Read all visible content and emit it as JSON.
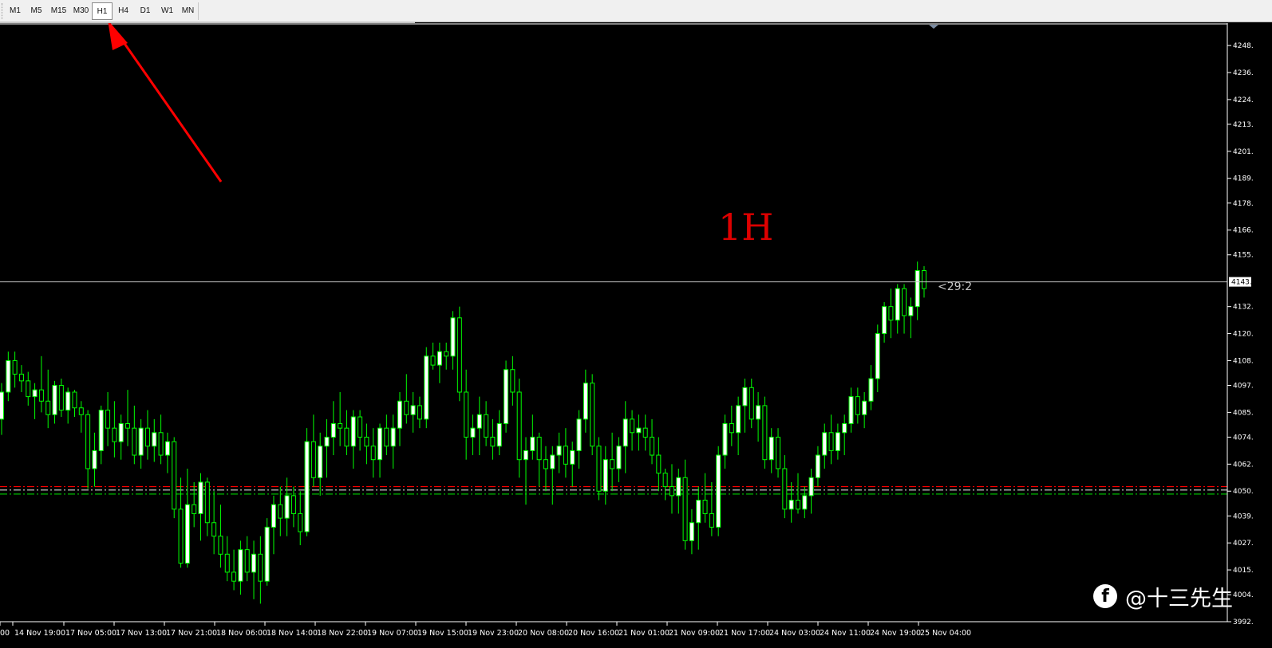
{
  "toolbar": {
    "timeframes": [
      {
        "label": "M1",
        "active": false
      },
      {
        "label": "M5",
        "active": false
      },
      {
        "label": "M15",
        "active": false
      },
      {
        "label": "M30",
        "active": false
      },
      {
        "label": "H1",
        "active": true
      },
      {
        "label": "H4",
        "active": false
      },
      {
        "label": "D1",
        "active": false
      },
      {
        "label": "W1",
        "active": false
      },
      {
        "label": "MN",
        "active": false
      }
    ]
  },
  "annotation": {
    "timeframe_label": "1H",
    "arrow_color": "#ff0000"
  },
  "price_axis": {
    "ticks": [
      "4248.",
      "4236.",
      "4224.",
      "4213.",
      "4201.",
      "4189.",
      "4178.",
      "4166.",
      "4155.",
      "4132.",
      "4120.",
      "4108.",
      "4097.",
      "4085.",
      "4074.",
      "4062.",
      "4050.",
      "4039.",
      "4027.",
      "4015.",
      "4004.",
      "3992."
    ],
    "current_price_label": "4143."
  },
  "countdown_label": "<29:2",
  "time_axis": {
    "ticks": [
      "00",
      "14 Nov 19:00",
      "17 Nov 05:00",
      "17 Nov 13:00",
      "17 Nov 21:00",
      "18 Nov 06:00",
      "18 Nov 14:00",
      "18 Nov 22:00",
      "19 Nov 07:00",
      "19 Nov 15:00",
      "19 Nov 23:00",
      "20 Nov 08:00",
      "20 Nov 16:00",
      "21 Nov 01:00",
      "21 Nov 09:00",
      "21 Nov 17:00",
      "24 Nov 03:00",
      "24 Nov 11:00",
      "24 Nov 19:00",
      "25 Nov 04:00"
    ]
  },
  "colors": {
    "background": "#000000",
    "bull_fill": "#ffffff",
    "bear_fill": "#000000",
    "candle_stroke": "#00ff00",
    "bid_line": "#c0c0c0",
    "level_line_red": "#ff0000",
    "level_line_white": "#e0e0e0",
    "level_line_green": "#00c000"
  },
  "watermark": {
    "icon": "facebook-icon",
    "text": "@十三先生"
  },
  "chart_data": {
    "type": "candlestick",
    "ylim": [
      3992,
      4253
    ],
    "current_price": 4143,
    "horizontal_levels": [
      {
        "price": 4052,
        "color": "#ff0000",
        "style": "dash-dot"
      },
      {
        "price": 4050.5,
        "color": "#e0e0e0",
        "style": "dash-dot"
      },
      {
        "price": 4048.7,
        "color": "#00c000",
        "style": "dash-dot"
      }
    ],
    "candles": [
      [
        4082,
        4098,
        4075,
        4094
      ],
      [
        4094,
        4112,
        4090,
        4108
      ],
      [
        4108,
        4112,
        4096,
        4102
      ],
      [
        4102,
        4106,
        4094,
        4099
      ],
      [
        4099,
        4103,
        4088,
        4092
      ],
      [
        4092,
        4098,
        4082,
        4095
      ],
      [
        4095,
        4110,
        4085,
        4090
      ],
      [
        4090,
        4104,
        4078,
        4084
      ],
      [
        4084,
        4099,
        4080,
        4097
      ],
      [
        4097,
        4100,
        4083,
        4086
      ],
      [
        4086,
        4096,
        4080,
        4094
      ],
      [
        4094,
        4095,
        4083,
        4087
      ],
      [
        4087,
        4090,
        4076,
        4084
      ],
      [
        4084,
        4086,
        4051,
        4060
      ],
      [
        4060,
        4076,
        4052,
        4068
      ],
      [
        4068,
        4088,
        4062,
        4086
      ],
      [
        4086,
        4094,
        4070,
        4078
      ],
      [
        4078,
        4090,
        4065,
        4072
      ],
      [
        4072,
        4084,
        4064,
        4080
      ],
      [
        4080,
        4095,
        4070,
        4078
      ],
      [
        4078,
        4088,
        4062,
        4066
      ],
      [
        4066,
        4082,
        4060,
        4078
      ],
      [
        4078,
        4086,
        4064,
        4070
      ],
      [
        4070,
        4082,
        4063,
        4076
      ],
      [
        4076,
        4084,
        4062,
        4066
      ],
      [
        4066,
        4076,
        4058,
        4072
      ],
      [
        4072,
        4074,
        4038,
        4042
      ],
      [
        4042,
        4056,
        4016,
        4018
      ],
      [
        4018,
        4060,
        4016,
        4044
      ],
      [
        4044,
        4054,
        4034,
        4040
      ],
      [
        4040,
        4058,
        4028,
        4054
      ],
      [
        4054,
        4056,
        4030,
        4036
      ],
      [
        4036,
        4050,
        4022,
        4030
      ],
      [
        4030,
        4044,
        4016,
        4022
      ],
      [
        4022,
        4030,
        4010,
        4014
      ],
      [
        4014,
        4024,
        4006,
        4010
      ],
      [
        4010,
        4028,
        4004,
        4024
      ],
      [
        4024,
        4030,
        4010,
        4014
      ],
      [
        4014,
        4028,
        4002,
        4022
      ],
      [
        4022,
        4030,
        4000,
        4010
      ],
      [
        4010,
        4038,
        4008,
        4034
      ],
      [
        4034,
        4048,
        4022,
        4044
      ],
      [
        4044,
        4052,
        4030,
        4038
      ],
      [
        4038,
        4056,
        4030,
        4048
      ],
      [
        4048,
        4052,
        4034,
        4040
      ],
      [
        4040,
        4050,
        4026,
        4032
      ],
      [
        4032,
        4078,
        4030,
        4072
      ],
      [
        4072,
        4084,
        4052,
        4056
      ],
      [
        4056,
        4076,
        4048,
        4070
      ],
      [
        4070,
        4082,
        4056,
        4074
      ],
      [
        4074,
        4090,
        4066,
        4080
      ],
      [
        4080,
        4094,
        4070,
        4078
      ],
      [
        4078,
        4086,
        4066,
        4070
      ],
      [
        4070,
        4086,
        4060,
        4083
      ],
      [
        4083,
        4086,
        4068,
        4074
      ],
      [
        4074,
        4080,
        4062,
        4070
      ],
      [
        4070,
        4078,
        4056,
        4064
      ],
      [
        4064,
        4080,
        4056,
        4078
      ],
      [
        4078,
        4084,
        4066,
        4070
      ],
      [
        4070,
        4084,
        4060,
        4078
      ],
      [
        4078,
        4094,
        4070,
        4090
      ],
      [
        4090,
        4102,
        4080,
        4084
      ],
      [
        4084,
        4094,
        4076,
        4088
      ],
      [
        4088,
        4092,
        4078,
        4082
      ],
      [
        4082,
        4114,
        4078,
        4110
      ],
      [
        4110,
        4116,
        4104,
        4106
      ],
      [
        4106,
        4116,
        4098,
        4112
      ],
      [
        4112,
        4116,
        4104,
        4110
      ],
      [
        4110,
        4130,
        4104,
        4127
      ],
      [
        4127,
        4132,
        4090,
        4094
      ],
      [
        4094,
        4104,
        4064,
        4074
      ],
      [
        4074,
        4084,
        4066,
        4078
      ],
      [
        4078,
        4092,
        4066,
        4084
      ],
      [
        4084,
        4090,
        4070,
        4074
      ],
      [
        4074,
        4082,
        4064,
        4070
      ],
      [
        4070,
        4086,
        4066,
        4080
      ],
      [
        4080,
        4108,
        4076,
        4104
      ],
      [
        4104,
        4110,
        4088,
        4094
      ],
      [
        4094,
        4100,
        4056,
        4064
      ],
      [
        4064,
        4074,
        4044,
        4068
      ],
      [
        4068,
        4084,
        4064,
        4074
      ],
      [
        4074,
        4076,
        4052,
        4064
      ],
      [
        4064,
        4070,
        4050,
        4060
      ],
      [
        4060,
        4070,
        4044,
        4066
      ],
      [
        4066,
        4076,
        4058,
        4070
      ],
      [
        4070,
        4078,
        4056,
        4062
      ],
      [
        4062,
        4072,
        4052,
        4068
      ],
      [
        4068,
        4086,
        4060,
        4082
      ],
      [
        4082,
        4104,
        4076,
        4098
      ],
      [
        4098,
        4102,
        4066,
        4070
      ],
      [
        4070,
        4074,
        4046,
        4050
      ],
      [
        4050,
        4070,
        4044,
        4064
      ],
      [
        4064,
        4076,
        4050,
        4060
      ],
      [
        4060,
        4074,
        4054,
        4070
      ],
      [
        4070,
        4090,
        4058,
        4082
      ],
      [
        4082,
        4086,
        4068,
        4076
      ],
      [
        4076,
        4084,
        4068,
        4078
      ],
      [
        4078,
        4084,
        4068,
        4074
      ],
      [
        4074,
        4082,
        4062,
        4066
      ],
      [
        4066,
        4074,
        4050,
        4058
      ],
      [
        4058,
        4060,
        4046,
        4052
      ],
      [
        4052,
        4062,
        4040,
        4048
      ],
      [
        4048,
        4060,
        4040,
        4056
      ],
      [
        4056,
        4064,
        4024,
        4028
      ],
      [
        4028,
        4042,
        4022,
        4036
      ],
      [
        4036,
        4052,
        4024,
        4046
      ],
      [
        4046,
        4058,
        4036,
        4040
      ],
      [
        4040,
        4054,
        4030,
        4034
      ],
      [
        4034,
        4070,
        4030,
        4066
      ],
      [
        4066,
        4084,
        4060,
        4080
      ],
      [
        4080,
        4088,
        4070,
        4076
      ],
      [
        4076,
        4092,
        4066,
        4088
      ],
      [
        4088,
        4100,
        4076,
        4096
      ],
      [
        4096,
        4100,
        4078,
        4082
      ],
      [
        4082,
        4094,
        4072,
        4088
      ],
      [
        4088,
        4092,
        4060,
        4064
      ],
      [
        4064,
        4078,
        4058,
        4074
      ],
      [
        4074,
        4078,
        4056,
        4060
      ],
      [
        4060,
        4066,
        4038,
        4042
      ],
      [
        4042,
        4054,
        4036,
        4046
      ],
      [
        4046,
        4058,
        4040,
        4042
      ],
      [
        4042,
        4052,
        4038,
        4048
      ],
      [
        4048,
        4060,
        4040,
        4056
      ],
      [
        4056,
        4070,
        4052,
        4066
      ],
      [
        4066,
        4080,
        4060,
        4076
      ],
      [
        4076,
        4084,
        4062,
        4068
      ],
      [
        4068,
        4080,
        4064,
        4076
      ],
      [
        4076,
        4084,
        4066,
        4080
      ],
      [
        4080,
        4096,
        4076,
        4092
      ],
      [
        4092,
        4096,
        4080,
        4084
      ],
      [
        4084,
        4094,
        4078,
        4090
      ],
      [
        4090,
        4106,
        4086,
        4100
      ],
      [
        4100,
        4124,
        4094,
        4120
      ],
      [
        4120,
        4134,
        4116,
        4132
      ],
      [
        4132,
        4140,
        4118,
        4126
      ],
      [
        4126,
        4142,
        4120,
        4140
      ],
      [
        4140,
        4142,
        4120,
        4128
      ],
      [
        4128,
        4136,
        4118,
        4132
      ],
      [
        4132,
        4152,
        4126,
        4148
      ],
      [
        4148,
        4150,
        4136,
        4140
      ]
    ]
  }
}
